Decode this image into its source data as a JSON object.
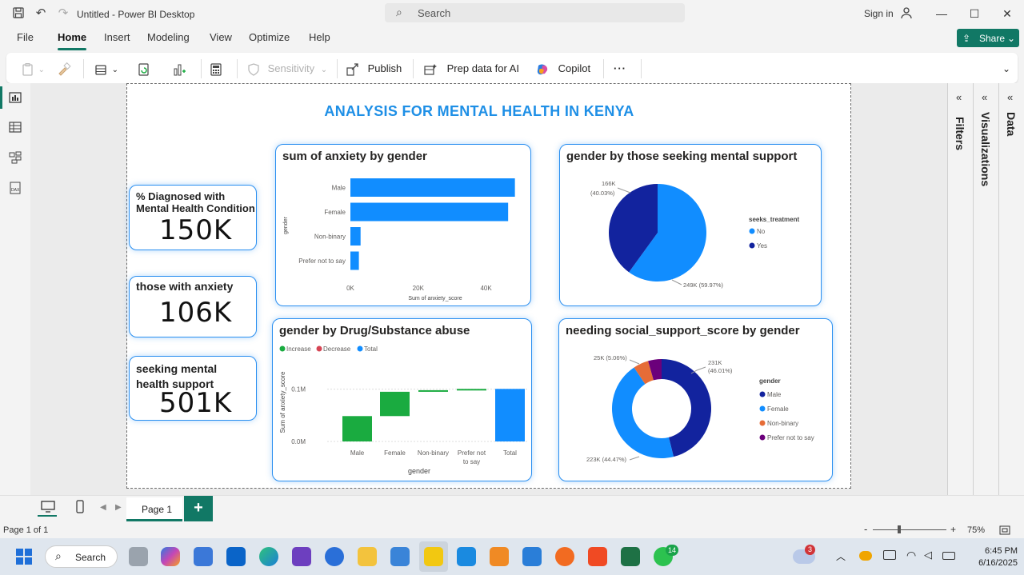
{
  "app": {
    "title": "Untitled - Power BI Desktop",
    "search_placeholder": "Search",
    "signin_label": "Sign in"
  },
  "menu": {
    "items": [
      "File",
      "Home",
      "Insert",
      "Modeling",
      "View",
      "Optimize",
      "Help"
    ],
    "active": "Home",
    "share_label": "Share"
  },
  "ribbon": {
    "sensitivity_label": "Sensitivity",
    "publish_label": "Publish",
    "prep_label": "Prep data for AI",
    "copilot_label": "Copilot",
    "more_label": "···"
  },
  "report": {
    "title": "ANALYSIS FOR MENTAL HEALTH IN KENYA",
    "kpis": [
      {
        "title": "% Diagnosed with Mental Health Condition",
        "value": "150K"
      },
      {
        "title": "those with anxiety",
        "value": "106K"
      },
      {
        "title": "seeking mental health support",
        "value": "501K"
      }
    ]
  },
  "chart_data": [
    {
      "type": "bar",
      "title": "sum of anxiety by gender",
      "categories": [
        "Male",
        "Female",
        "Non-binary",
        "Prefer not to say"
      ],
      "values": [
        48500,
        46500,
        3000,
        2500
      ],
      "xlabel": "Sum of anxiety_score",
      "ylabel": "gender",
      "xticks": [
        "0K",
        "20K",
        "40K"
      ],
      "xlim": [
        0,
        50000
      ],
      "color": "#118dff"
    },
    {
      "type": "pie",
      "title": "gender by those seeking mental support",
      "legend_title": "seeks_treatment",
      "labels": [
        "No",
        "Yes"
      ],
      "values": [
        249000,
        166000
      ],
      "data_labels": [
        "249K (59.97%)",
        "166K (40.03%)"
      ],
      "colors": [
        "#118dff",
        "#12239e"
      ]
    },
    {
      "type": "bar",
      "subtype": "waterfall",
      "title": "gender by Drug/Substance abuse",
      "legend": [
        "Increase",
        "Decrease",
        "Total"
      ],
      "legend_colors": [
        "#1aab40",
        "#d64554",
        "#118dff"
      ],
      "categories": [
        "Male",
        "Female",
        "Non-binary",
        "Prefer not to say",
        "Total"
      ],
      "values": [
        48500,
        46500,
        3000,
        2500,
        100500
      ],
      "ylabel": "Sum of anxiety_score",
      "xlabel": "gender",
      "yticks": [
        "0.0M",
        "0.1M"
      ],
      "ylim": [
        0,
        130000
      ]
    },
    {
      "type": "pie",
      "subtype": "donut",
      "title": "needing social_support_score by gender",
      "legend_title": "gender",
      "labels": [
        "Male",
        "Female",
        "Non-binary",
        "Prefer not to say"
      ],
      "values": [
        231000,
        223000,
        25000,
        22000
      ],
      "data_labels": [
        "231K (46.01%)",
        "223K (44.47%)",
        "25K (5.06%)",
        ""
      ],
      "colors": [
        "#12239e",
        "#118dff",
        "#e66c37",
        "#6b007b"
      ]
    }
  ],
  "pages": {
    "tab_label": "Page 1",
    "status": "Page 1 of 1",
    "zoom": "75%"
  },
  "panes": {
    "filters": "Filters",
    "visualizations": "Visualizations",
    "data": "Data"
  },
  "taskbar": {
    "search_label": "Search",
    "time": "6:45 PM",
    "date": "6/16/2025",
    "weather_badge": "3",
    "whatsapp_badge": "14"
  }
}
